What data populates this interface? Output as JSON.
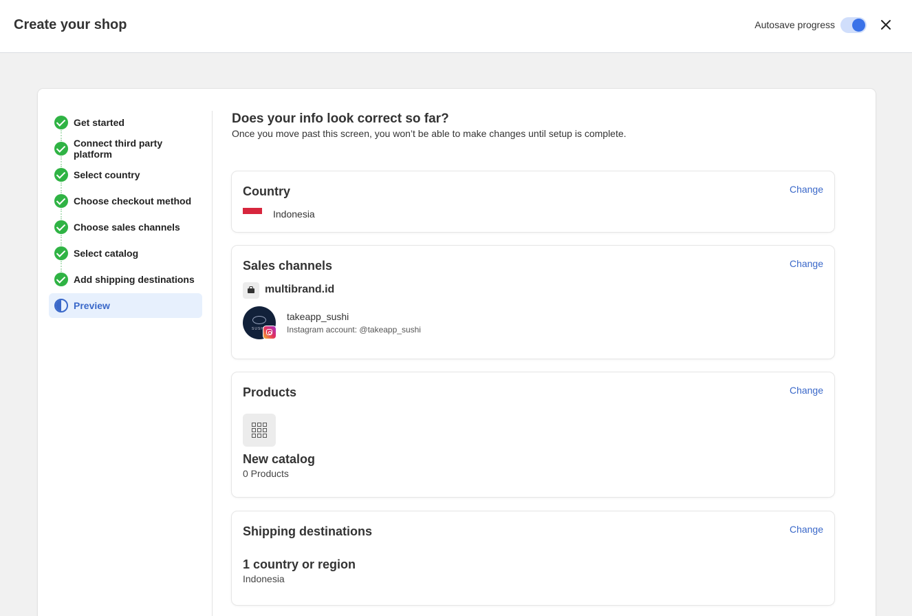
{
  "header": {
    "title": "Create your shop",
    "autosave_label": "Autosave progress",
    "autosave_on": true
  },
  "steps": [
    {
      "label": "Get started",
      "status": "complete"
    },
    {
      "label": "Connect third party platform",
      "status": "complete"
    },
    {
      "label": "Select country",
      "status": "complete"
    },
    {
      "label": "Choose checkout method",
      "status": "complete"
    },
    {
      "label": "Choose sales channels",
      "status": "complete"
    },
    {
      "label": "Select catalog",
      "status": "complete"
    },
    {
      "label": "Add shipping destinations",
      "status": "complete"
    },
    {
      "label": "Preview",
      "status": "current"
    }
  ],
  "main": {
    "heading": "Does your info look correct so far?",
    "subheading": "Once you move past this screen, you won’t be able to make changes until setup is complete."
  },
  "country_section": {
    "title": "Country",
    "change_label": "Change",
    "country": "Indonesia"
  },
  "sales_section": {
    "title": "Sales channels",
    "change_label": "Change",
    "shop_name": "multibrand.id",
    "instagram_name": "takeapp_sushi",
    "instagram_account": "Instagram account: @takeapp_sushi"
  },
  "products_section": {
    "title": "Products",
    "change_label": "Change",
    "catalog_name": "New catalog",
    "catalog_count": "0 Products"
  },
  "shipping_section": {
    "title": "Shipping destinations",
    "change_label": "Change",
    "count_label": "1 country or region",
    "country": "Indonesia"
  },
  "colors": {
    "accent": "#3a68c9",
    "complete": "#2fb344"
  }
}
